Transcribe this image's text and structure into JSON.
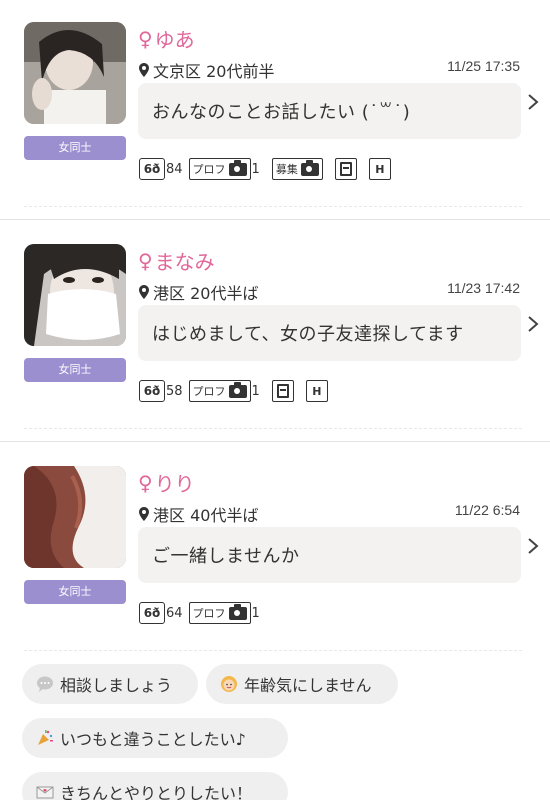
{
  "icons": {
    "female": "♀",
    "location": "location-pin-icon",
    "chevron": "chevron-right-icon",
    "views": "glasses-icon",
    "photo": "camera-icon",
    "recruit": "camera-icon",
    "memo": "document-icon",
    "hotel": "H"
  },
  "colors": {
    "name": "#e0689a",
    "tag": "#9b8fd0",
    "bubble": "#f3f2f1",
    "chip": "#efefef"
  },
  "users": [
    {
      "name": "ゆあ",
      "tag": "女同士",
      "location": "文京区 20代前半",
      "time": "11/25 17:35",
      "message": "おんなのことお話したい (˙꒳˙)",
      "views": "84",
      "profile_label": "プロフ",
      "profile_count": "1",
      "recruit_label": "募集",
      "hotel_label": "H"
    },
    {
      "name": "まなみ",
      "tag": "女同士",
      "location": "港区 20代半ば",
      "time": "11/23 17:42",
      "message": "はじめまして、女の子友達探してます",
      "views": "58",
      "profile_label": "プロフ",
      "profile_count": "1",
      "hotel_label": "H"
    },
    {
      "name": "りり",
      "tag": "女同士",
      "location": "港区 40代半ば",
      "time": "11/22 6:54",
      "message": "ご一緒しませんか",
      "views": "64",
      "profile_label": "プロフ",
      "profile_count": "1"
    }
  ],
  "chips": [
    {
      "label": "相談しましょう",
      "icon": "speech-bubble-icon"
    },
    {
      "label": "年齢気にしません",
      "icon": "smiley-face-icon"
    },
    {
      "label": "いつもと違うことしたい♪",
      "icon": "party-popper-icon"
    },
    {
      "label": "きちんとやりとりしたい！",
      "icon": "envelope-icon"
    }
  ]
}
